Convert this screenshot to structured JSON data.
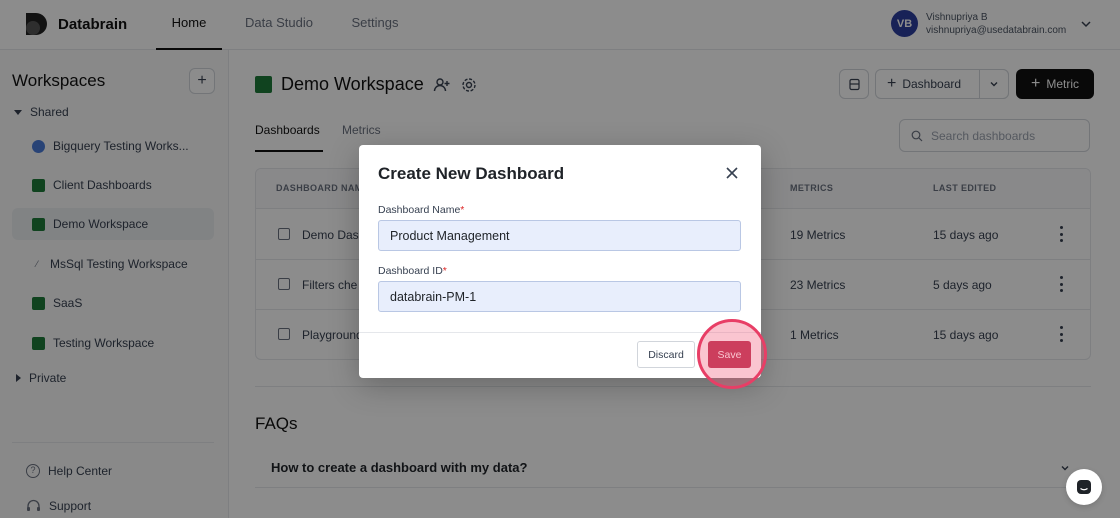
{
  "app": {
    "brand": "Databrain",
    "nav": [
      "Home",
      "Data Studio",
      "Settings"
    ],
    "user": {
      "initials": "VB",
      "name": "Vishnupriya B",
      "email": "vishnupriya@usedatabrain.com"
    }
  },
  "sidebar": {
    "title": "Workspaces",
    "shared_label": "Shared",
    "private_label": "Private",
    "items": [
      {
        "label": "Bigquery Testing Works...",
        "icon": "bigquery-icon"
      },
      {
        "label": "Client Dashboards",
        "icon": "workspace-icon"
      },
      {
        "label": "Demo Workspace",
        "icon": "workspace-icon"
      },
      {
        "label": "MsSql Testing Workspace",
        "icon": "mssql-icon"
      },
      {
        "label": "SaaS",
        "icon": "workspace-icon"
      },
      {
        "label": "Testing Workspace",
        "icon": "workspace-icon"
      }
    ],
    "help": "Help Center",
    "support": "Support"
  },
  "main": {
    "title": "Demo Workspace",
    "dashboard_btn": "Dashboard",
    "metric_btn": "Metric",
    "tabs": [
      "Dashboards",
      "Metrics"
    ],
    "search_placeholder": "Search dashboards",
    "columns": [
      "DASHBOARD NAME",
      "METRICS",
      "LAST EDITED"
    ],
    "rows": [
      {
        "name": "Demo Das",
        "metrics": "19 Metrics",
        "edited": "15 days ago"
      },
      {
        "name": "Filters che",
        "metrics": "23 Metrics",
        "edited": "5 days ago"
      },
      {
        "name": "Playground",
        "metrics": "1 Metrics",
        "edited": "15 days ago"
      }
    ],
    "faq_title": "FAQs",
    "faq_q1": "How to create a dashboard with my data?"
  },
  "modal": {
    "title": "Create New Dashboard",
    "name_label": "Dashboard Name",
    "name_value": "Product Management",
    "id_label": "Dashboard ID",
    "id_value": "databrain-PM-1",
    "required_mark": "*",
    "discard": "Discard",
    "save": "Save"
  },
  "colors": {
    "accent": "#b8304f",
    "highlight": "#e83e66",
    "workspace": "#1e7a3a"
  }
}
